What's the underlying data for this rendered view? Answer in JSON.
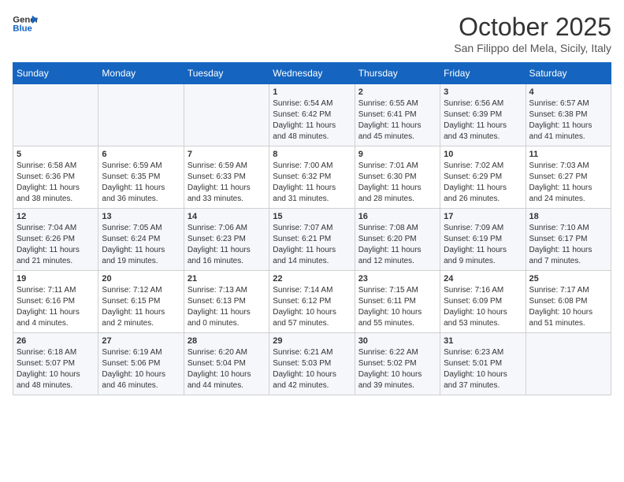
{
  "header": {
    "logo_line1": "General",
    "logo_line2": "Blue",
    "title": "October 2025",
    "subtitle": "San Filippo del Mela, Sicily, Italy"
  },
  "days_of_week": [
    "Sunday",
    "Monday",
    "Tuesday",
    "Wednesday",
    "Thursday",
    "Friday",
    "Saturday"
  ],
  "weeks": [
    [
      {
        "day": "",
        "info": ""
      },
      {
        "day": "",
        "info": ""
      },
      {
        "day": "",
        "info": ""
      },
      {
        "day": "1",
        "info": "Sunrise: 6:54 AM\nSunset: 6:42 PM\nDaylight: 11 hours\nand 48 minutes."
      },
      {
        "day": "2",
        "info": "Sunrise: 6:55 AM\nSunset: 6:41 PM\nDaylight: 11 hours\nand 45 minutes."
      },
      {
        "day": "3",
        "info": "Sunrise: 6:56 AM\nSunset: 6:39 PM\nDaylight: 11 hours\nand 43 minutes."
      },
      {
        "day": "4",
        "info": "Sunrise: 6:57 AM\nSunset: 6:38 PM\nDaylight: 11 hours\nand 41 minutes."
      }
    ],
    [
      {
        "day": "5",
        "info": "Sunrise: 6:58 AM\nSunset: 6:36 PM\nDaylight: 11 hours\nand 38 minutes."
      },
      {
        "day": "6",
        "info": "Sunrise: 6:59 AM\nSunset: 6:35 PM\nDaylight: 11 hours\nand 36 minutes."
      },
      {
        "day": "7",
        "info": "Sunrise: 6:59 AM\nSunset: 6:33 PM\nDaylight: 11 hours\nand 33 minutes."
      },
      {
        "day": "8",
        "info": "Sunrise: 7:00 AM\nSunset: 6:32 PM\nDaylight: 11 hours\nand 31 minutes."
      },
      {
        "day": "9",
        "info": "Sunrise: 7:01 AM\nSunset: 6:30 PM\nDaylight: 11 hours\nand 28 minutes."
      },
      {
        "day": "10",
        "info": "Sunrise: 7:02 AM\nSunset: 6:29 PM\nDaylight: 11 hours\nand 26 minutes."
      },
      {
        "day": "11",
        "info": "Sunrise: 7:03 AM\nSunset: 6:27 PM\nDaylight: 11 hours\nand 24 minutes."
      }
    ],
    [
      {
        "day": "12",
        "info": "Sunrise: 7:04 AM\nSunset: 6:26 PM\nDaylight: 11 hours\nand 21 minutes."
      },
      {
        "day": "13",
        "info": "Sunrise: 7:05 AM\nSunset: 6:24 PM\nDaylight: 11 hours\nand 19 minutes."
      },
      {
        "day": "14",
        "info": "Sunrise: 7:06 AM\nSunset: 6:23 PM\nDaylight: 11 hours\nand 16 minutes."
      },
      {
        "day": "15",
        "info": "Sunrise: 7:07 AM\nSunset: 6:21 PM\nDaylight: 11 hours\nand 14 minutes."
      },
      {
        "day": "16",
        "info": "Sunrise: 7:08 AM\nSunset: 6:20 PM\nDaylight: 11 hours\nand 12 minutes."
      },
      {
        "day": "17",
        "info": "Sunrise: 7:09 AM\nSunset: 6:19 PM\nDaylight: 11 hours\nand 9 minutes."
      },
      {
        "day": "18",
        "info": "Sunrise: 7:10 AM\nSunset: 6:17 PM\nDaylight: 11 hours\nand 7 minutes."
      }
    ],
    [
      {
        "day": "19",
        "info": "Sunrise: 7:11 AM\nSunset: 6:16 PM\nDaylight: 11 hours\nand 4 minutes."
      },
      {
        "day": "20",
        "info": "Sunrise: 7:12 AM\nSunset: 6:15 PM\nDaylight: 11 hours\nand 2 minutes."
      },
      {
        "day": "21",
        "info": "Sunrise: 7:13 AM\nSunset: 6:13 PM\nDaylight: 11 hours\nand 0 minutes."
      },
      {
        "day": "22",
        "info": "Sunrise: 7:14 AM\nSunset: 6:12 PM\nDaylight: 10 hours\nand 57 minutes."
      },
      {
        "day": "23",
        "info": "Sunrise: 7:15 AM\nSunset: 6:11 PM\nDaylight: 10 hours\nand 55 minutes."
      },
      {
        "day": "24",
        "info": "Sunrise: 7:16 AM\nSunset: 6:09 PM\nDaylight: 10 hours\nand 53 minutes."
      },
      {
        "day": "25",
        "info": "Sunrise: 7:17 AM\nSunset: 6:08 PM\nDaylight: 10 hours\nand 51 minutes."
      }
    ],
    [
      {
        "day": "26",
        "info": "Sunrise: 6:18 AM\nSunset: 5:07 PM\nDaylight: 10 hours\nand 48 minutes."
      },
      {
        "day": "27",
        "info": "Sunrise: 6:19 AM\nSunset: 5:06 PM\nDaylight: 10 hours\nand 46 minutes."
      },
      {
        "day": "28",
        "info": "Sunrise: 6:20 AM\nSunset: 5:04 PM\nDaylight: 10 hours\nand 44 minutes."
      },
      {
        "day": "29",
        "info": "Sunrise: 6:21 AM\nSunset: 5:03 PM\nDaylight: 10 hours\nand 42 minutes."
      },
      {
        "day": "30",
        "info": "Sunrise: 6:22 AM\nSunset: 5:02 PM\nDaylight: 10 hours\nand 39 minutes."
      },
      {
        "day": "31",
        "info": "Sunrise: 6:23 AM\nSunset: 5:01 PM\nDaylight: 10 hours\nand 37 minutes."
      },
      {
        "day": "",
        "info": ""
      }
    ]
  ]
}
